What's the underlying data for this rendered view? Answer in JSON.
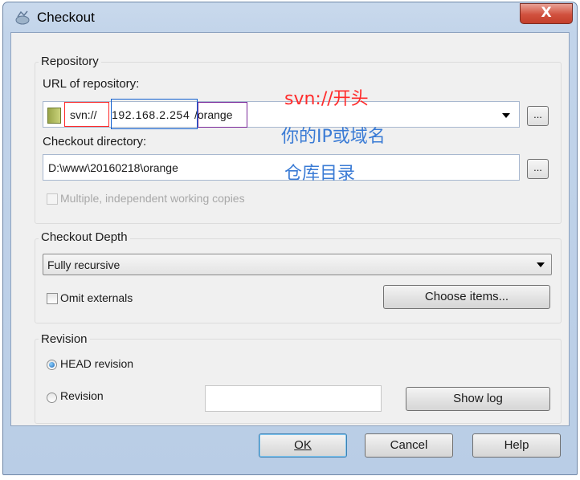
{
  "window": {
    "title": "Checkout",
    "close_label": "X"
  },
  "repository": {
    "group_label": "Repository",
    "url_label": "URL of repository:",
    "url_value": {
      "scheme": "svn://",
      "host": "192.168.2.254",
      "path": "/orange"
    },
    "dir_label": "Checkout directory:",
    "dir_value": "D:\\www\\20160218\\orange",
    "browse_label": "...",
    "multiple_label": "Multiple, independent working copies",
    "multiple_checked": false
  },
  "annotations": {
    "scheme_note": "svn://开头",
    "host_note": "你的IP或域名",
    "dir_note": "仓库目录",
    "colors": {
      "scheme": "#ff2b2b",
      "host": "#1060d0",
      "path": "#7a2a9a",
      "text": "#3a7bd5"
    }
  },
  "depth": {
    "group_label": "Checkout Depth",
    "selected": "Fully recursive",
    "omit_label": "Omit externals",
    "omit_checked": false,
    "choose_label": "Choose items..."
  },
  "revision": {
    "group_label": "Revision",
    "head_label": "HEAD revision",
    "rev_label": "Revision",
    "selected": "HEAD revision",
    "rev_value": "",
    "show_log_label": "Show log"
  },
  "footer": {
    "ok_label": "OK",
    "cancel_label": "Cancel",
    "help_label": "Help"
  }
}
